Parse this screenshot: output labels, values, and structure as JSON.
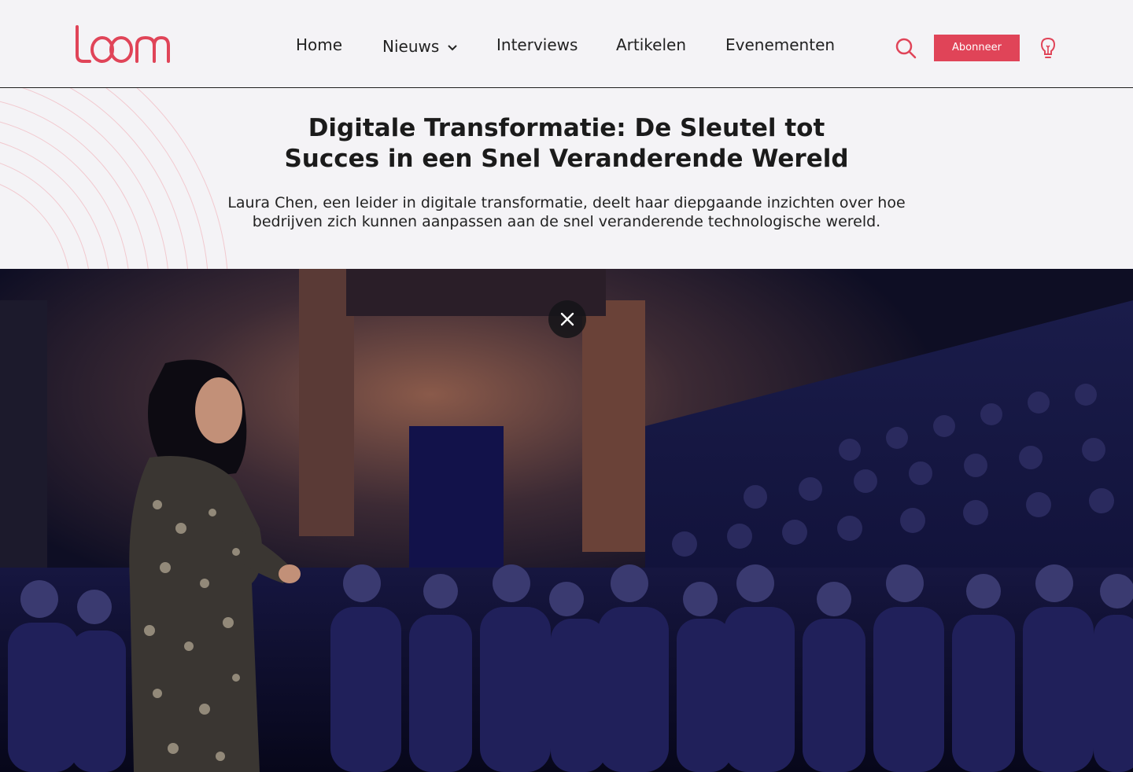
{
  "header": {
    "logo_text": "loom",
    "nav": [
      {
        "label": "Home"
      },
      {
        "label": "Nieuws",
        "has_dropdown": true
      },
      {
        "label": "Interviews"
      },
      {
        "label": "Artikelen"
      },
      {
        "label": "Evenementen"
      }
    ],
    "search_icon": "search-icon",
    "subscribe_label": "Abonneer",
    "idea_icon": "lightbulb-icon"
  },
  "article": {
    "title_line1": "Digitale Transformatie: De Sleutel tot",
    "title_line2": "Succes in een Snel Veranderende Wereld",
    "subtitle_line1": "Laura Chen, een leider in digitale transformatie, deelt haar diepgaande inzichten over hoe",
    "subtitle_line2": "bedrijven zich kunnen aanpassen aan de snel veranderende technologische wereld."
  },
  "video": {
    "close_icon": "close-icon"
  },
  "colors": {
    "brand": "#e04458",
    "background": "#f4f3f6",
    "text": "#1b1b1b"
  }
}
